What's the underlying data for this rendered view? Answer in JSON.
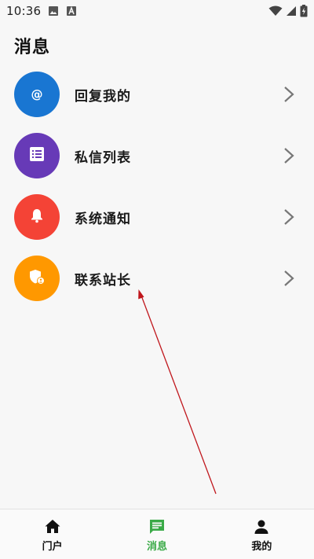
{
  "status_bar": {
    "time": "10:36",
    "icons": [
      "image-icon",
      "text-a-icon",
      "wifi-icon",
      "signal-icon",
      "battery-charging-icon"
    ]
  },
  "header": {
    "title": "消息"
  },
  "messages": {
    "items": [
      {
        "label": "回复我的",
        "icon": "at-icon",
        "color": "#1976d2"
      },
      {
        "label": "私信列表",
        "icon": "list-icon",
        "color": "#673ab7"
      },
      {
        "label": "系统通知",
        "icon": "bell-icon",
        "color": "#f44336"
      },
      {
        "label": "联系站长",
        "icon": "admin-shield-icon",
        "color": "#ff9800"
      }
    ],
    "chevron_icon": "chevron-right-icon"
  },
  "bottom_nav": {
    "items": [
      {
        "label": "门户",
        "icon": "home-icon",
        "active": false
      },
      {
        "label": "消息",
        "icon": "chat-icon",
        "active": true
      },
      {
        "label": "我的",
        "icon": "person-icon",
        "active": false
      }
    ],
    "active_color": "#3aaa47"
  },
  "annotation": {
    "color": "#c0161c"
  }
}
